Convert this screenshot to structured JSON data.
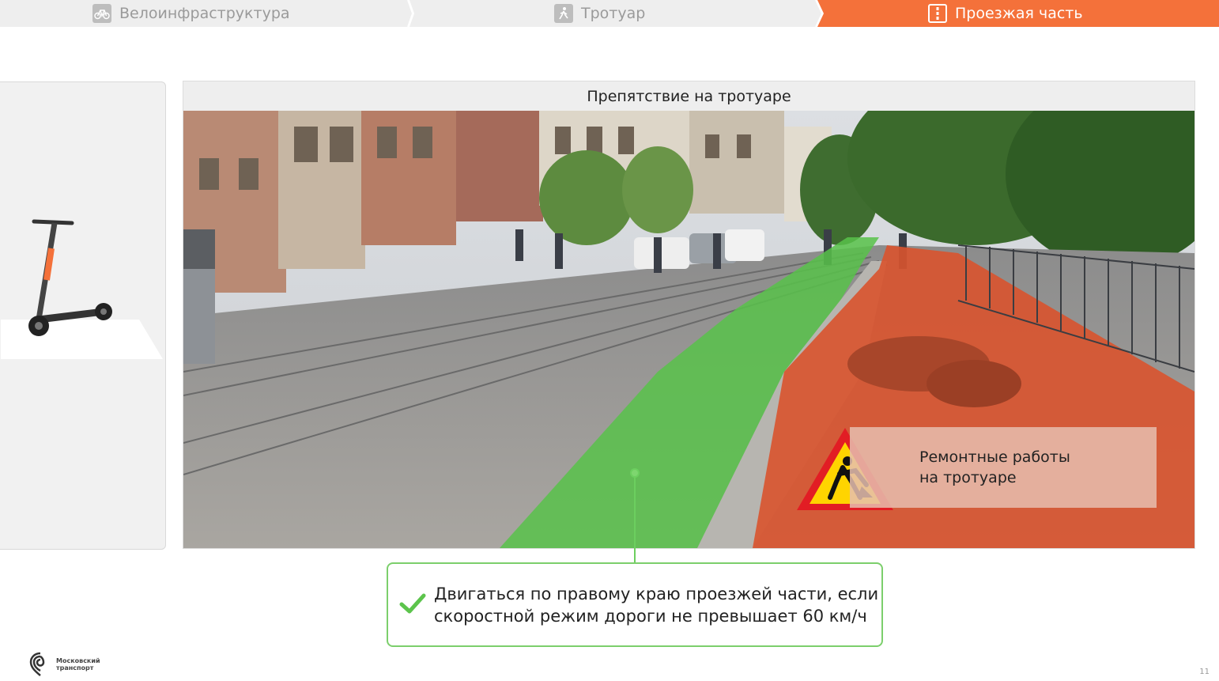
{
  "steps": [
    {
      "label": "Велоинфраструктура",
      "icon": "bicycle-icon",
      "state": "inactive"
    },
    {
      "label": "Тротуар",
      "icon": "pedestrian-icon",
      "state": "inactive"
    },
    {
      "label": "Проезжая часть",
      "icon": "road-icon",
      "state": "active"
    }
  ],
  "colors": {
    "accent": "#f4713a",
    "inactive_step": "#eeeeee",
    "green": "#6ccf5f",
    "red_zone": "#d9532e"
  },
  "panel": {
    "title": "Препятствие на тротуаре"
  },
  "sign_note": {
    "text": "Ремонтные работы\nна тротуаре",
    "icon": "road-works-sign-icon"
  },
  "callout": {
    "text": "Двигаться по правому краю проезжей части, если\nскоростной режим дороги не превышает 60 км/ч",
    "icon": "check-icon"
  },
  "footer": {
    "logo_text": "Московский\nтранспорт",
    "page_number": "11"
  }
}
